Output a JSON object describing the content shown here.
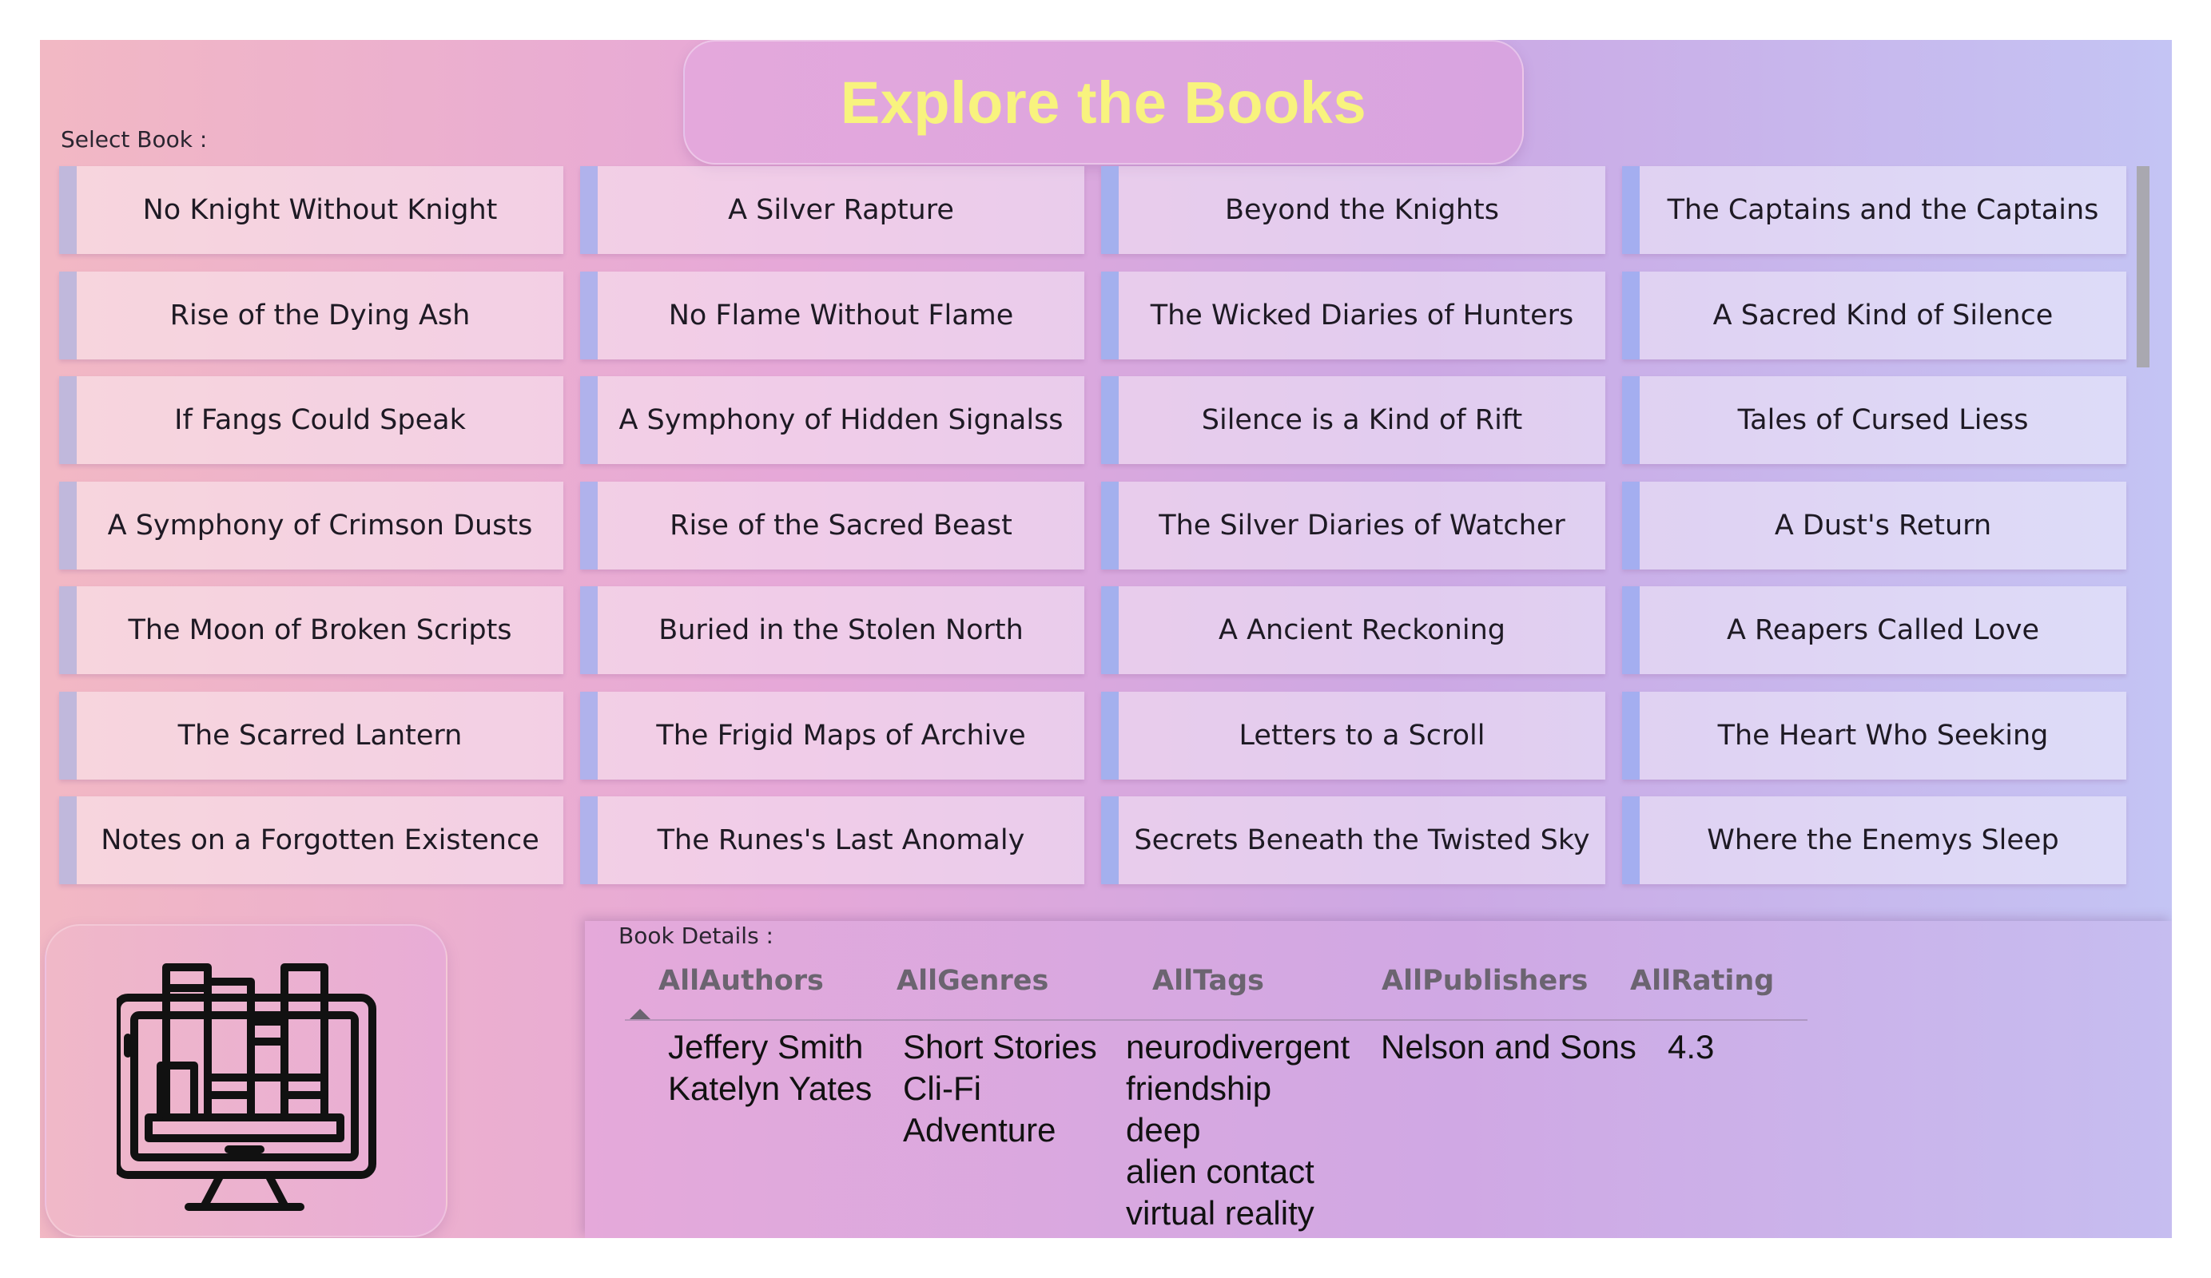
{
  "header": {
    "title": "Explore the Books"
  },
  "select_label": "Select Book :",
  "books": [
    [
      "No Knight Without Knight",
      "A Silver Rapture",
      "Beyond the Knights",
      "The Captains and the Captains"
    ],
    [
      "Rise of the Dying Ash",
      "No Flame Without Flame",
      "The Wicked Diaries of Hunters",
      "A Sacred Kind of Silence"
    ],
    [
      "If Fangs Could Speak",
      "A Symphony of Hidden Signalss",
      "Silence is a Kind of Rift",
      "Tales of Cursed Liess"
    ],
    [
      "A Symphony of Crimson Dusts",
      "Rise of the Sacred Beast",
      "The Silver Diaries of Watcher",
      "A Dust's Return"
    ],
    [
      "The Moon of Broken Scripts",
      "Buried in the Stolen North",
      "A Ancient Reckoning",
      "A Reapers Called Love"
    ],
    [
      "The Scarred Lantern",
      "The Frigid Maps of Archive",
      "Letters to a Scroll",
      "The Heart Who Seeking"
    ],
    [
      "Notes on a Forgotten Existence",
      "The Runes's Last Anomaly",
      "Secrets Beneath the Twisted Sky",
      "Where the Enemys Sleep"
    ]
  ],
  "accent_colors": [
    "#c0b8dc",
    "#b0b2ec",
    "#a4b0ee",
    "#a4aef0"
  ],
  "details": {
    "label": "Book Details :",
    "columns": [
      {
        "header": "AllAuthors",
        "values": [
          "Jeffery Smith",
          "Katelyn Yates"
        ]
      },
      {
        "header": "AllGenres",
        "values": [
          "Short Stories",
          "Cli-Fi",
          "Adventure"
        ]
      },
      {
        "header": "AllTags",
        "values": [
          "neurodivergent",
          "friendship",
          "deep",
          "alien contact",
          "virtual reality"
        ]
      },
      {
        "header": "AllPublishers",
        "values": [
          "Nelson and Sons"
        ]
      },
      {
        "header": "AllRating",
        "values": [
          "4.3"
        ]
      }
    ]
  },
  "logo": {
    "icon": "books-on-monitor-icon"
  }
}
